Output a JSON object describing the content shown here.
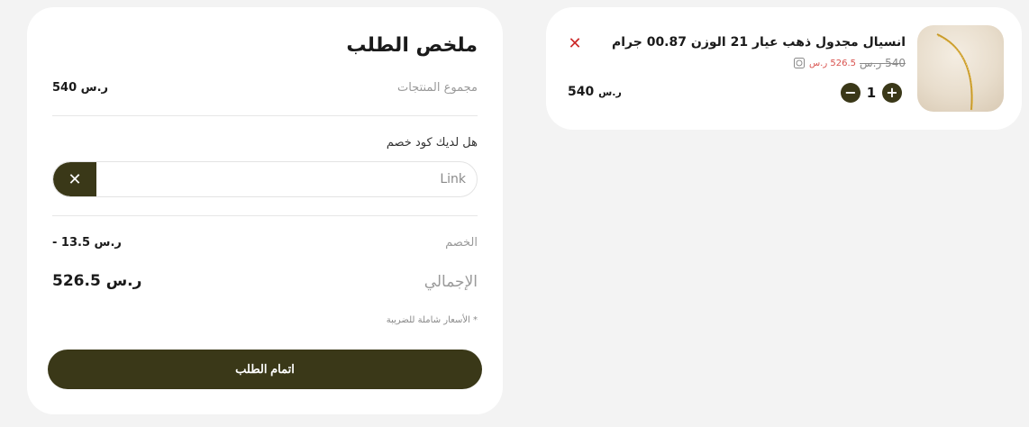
{
  "summary": {
    "title": "ملخص الطلب",
    "subtotal_label": "مجموع المنتجات",
    "subtotal_value": "540 ر.س",
    "coupon_question": "هل لديك كود خصم",
    "coupon_value": "Link",
    "discount_label": "الخصم",
    "discount_value": "- 13.5 ر.س",
    "total_label": "الإجمالي",
    "total_value": "526.5 ر.س",
    "tax_note": "* الأسعار شاملة للضريبة",
    "checkout_label": "اتمام الطلب"
  },
  "cart": {
    "items": [
      {
        "name": "انسيال مجدول ذهب عيار 21 الوزن 00.87 جرام",
        "old_price": "540 ر.س",
        "new_price": "526.5 ر.س",
        "quantity": "1",
        "line_total": "540",
        "line_currency": "ر.س",
        "thumb_icon": "bracelet-image"
      }
    ]
  },
  "colors": {
    "accent": "#3a3818",
    "remove": "#cc2a2a",
    "sale_price": "#d9534f"
  }
}
